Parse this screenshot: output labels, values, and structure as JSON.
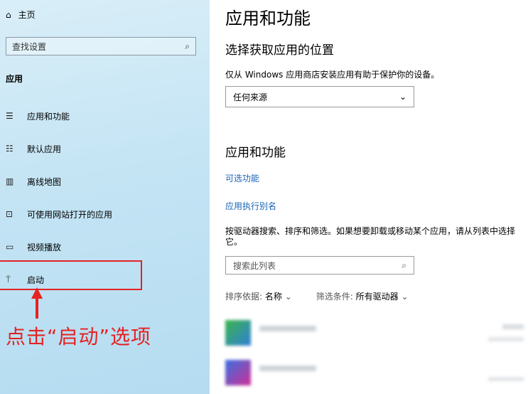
{
  "sidebar": {
    "home_label": "主页",
    "search_placeholder": "查找设置",
    "section_title": "应用",
    "items": [
      {
        "icon": "list-icon",
        "glyph": "☰",
        "label": "应用和功能"
      },
      {
        "icon": "default-apps-icon",
        "glyph": "☷",
        "label": "默认应用"
      },
      {
        "icon": "map-icon",
        "glyph": "▥",
        "label": "离线地图"
      },
      {
        "icon": "web-app-icon",
        "glyph": "⊡",
        "label": "可使用网站打开的应用"
      },
      {
        "icon": "video-icon",
        "glyph": "▭",
        "label": "视频播放"
      },
      {
        "icon": "startup-icon",
        "glyph": "⍑",
        "label": "启动"
      }
    ]
  },
  "annotation": {
    "text": "点击“启动”选项",
    "color": "#e52222"
  },
  "main": {
    "title": "应用和功能",
    "choose_heading": "选择获取应用的位置",
    "choose_desc": "仅从 Windows 应用商店安装应用有助于保护你的设备。",
    "source_dropdown": "任何来源",
    "apps_heading": "应用和功能",
    "link_optional": "可选功能",
    "link_alias": "应用执行别名",
    "search_desc": "按驱动器搜索、排序和筛选。如果想要卸载或移动某个应用，请从列表中选择它。",
    "list_search_placeholder": "搜索此列表",
    "sort_label": "排序依据:",
    "sort_value": "名称",
    "filter_label": "筛选条件:",
    "filter_value": "所有驱动器",
    "link_color": "#1a63b5"
  }
}
